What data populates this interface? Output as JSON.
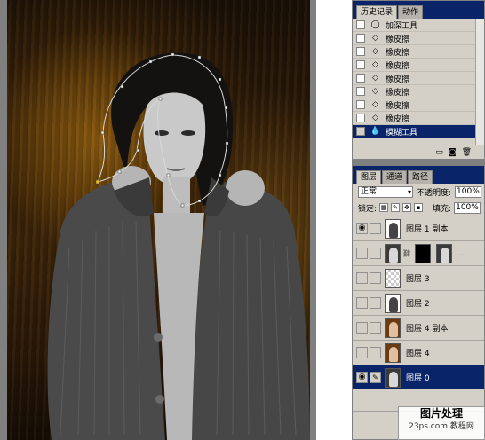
{
  "history": {
    "tabs": [
      "历史记录",
      "动作"
    ],
    "items": [
      {
        "label": "加深工具",
        "icon": "burn-tool-icon",
        "glyph": "◯",
        "selected": false
      },
      {
        "label": "橡皮擦",
        "icon": "eraser-icon",
        "glyph": "◇",
        "selected": false
      },
      {
        "label": "橡皮擦",
        "icon": "eraser-icon",
        "glyph": "◇",
        "selected": false
      },
      {
        "label": "橡皮擦",
        "icon": "eraser-icon",
        "glyph": "◇",
        "selected": false
      },
      {
        "label": "橡皮擦",
        "icon": "eraser-icon",
        "glyph": "◇",
        "selected": false
      },
      {
        "label": "橡皮擦",
        "icon": "eraser-icon",
        "glyph": "◇",
        "selected": false
      },
      {
        "label": "橡皮擦",
        "icon": "eraser-icon",
        "glyph": "◇",
        "selected": false
      },
      {
        "label": "橡皮擦",
        "icon": "eraser-icon",
        "glyph": "◇",
        "selected": false
      },
      {
        "label": "模糊工具",
        "icon": "blur-tool-icon",
        "glyph": "💧",
        "selected": true
      }
    ]
  },
  "layers": {
    "tabs": [
      "图层",
      "通道",
      "路径"
    ],
    "blend_mode": "正常",
    "opacity_label": "不透明度:",
    "opacity_value": "100%",
    "lock_label": "锁定:",
    "fill_label": "填充:",
    "fill_value": "100%",
    "items": [
      {
        "name": "图层 1 副本",
        "visible": true,
        "thumb": "white",
        "selected": false,
        "mask": false
      },
      {
        "name": "",
        "visible": false,
        "thumb": "dark",
        "selected": false,
        "mask": true
      },
      {
        "name": "图层 3",
        "visible": false,
        "thumb": "checker",
        "selected": false,
        "mask": false
      },
      {
        "name": "图层 2",
        "visible": false,
        "thumb": "white",
        "selected": false,
        "mask": false
      },
      {
        "name": "图层 4 副本",
        "visible": false,
        "thumb": "warm",
        "selected": false,
        "mask": false
      },
      {
        "name": "图层 4",
        "visible": false,
        "thumb": "warm",
        "selected": false,
        "mask": false
      },
      {
        "name": "图层 0",
        "visible": true,
        "thumb": "dark",
        "selected": true,
        "mask": false
      }
    ]
  },
  "watermark": {
    "line1": "图片处理",
    "line2": "23ps.com 教程网"
  }
}
